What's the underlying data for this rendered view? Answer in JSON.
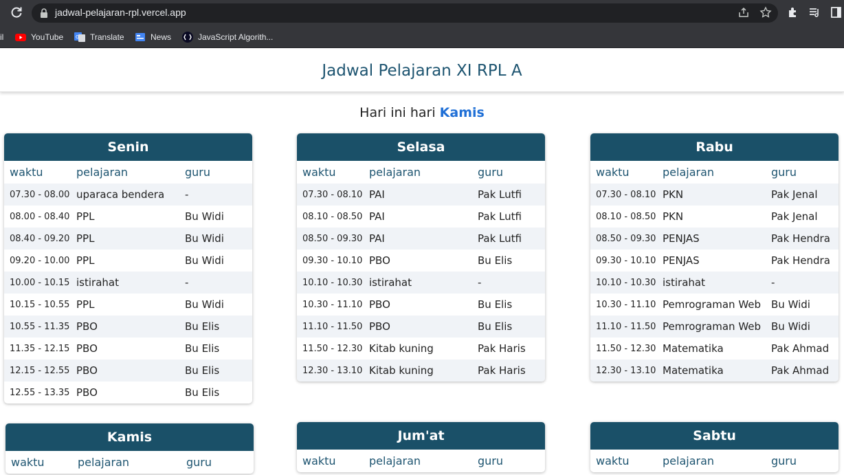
{
  "browser": {
    "url": "jadwal-pelajaran-rpl.vercel.app",
    "bookmarks": [
      {
        "label": "il",
        "icon": "bookmark-icon"
      },
      {
        "label": "YouTube",
        "icon": "youtube-icon",
        "color": "#ff0000"
      },
      {
        "label": "Translate",
        "icon": "translate-icon",
        "color": "#4285f4"
      },
      {
        "label": "News",
        "icon": "news-icon",
        "color": "#4285f4"
      },
      {
        "label": "JavaScript Algorith...",
        "icon": "freecodecamp-icon"
      }
    ]
  },
  "page": {
    "title": "Jadwal Pelajaran XI RPL A",
    "today_prefix": "Hari ini hari ",
    "today_day": "Kamis"
  },
  "colors": {
    "header": "#1a5068",
    "accent": "#1f6fd6",
    "title": "#1d5470"
  },
  "columns": {
    "time": "waktu",
    "subject": "pelajaran",
    "teacher": "guru"
  },
  "days": [
    {
      "name": "Senin",
      "rows": [
        [
          "07.30 - 08.00",
          "uparaca bendera",
          "-"
        ],
        [
          "08.00 - 08.40",
          "PPL",
          "Bu Widi"
        ],
        [
          "08.40 - 09.20",
          "PPL",
          "Bu Widi"
        ],
        [
          "09.20 - 10.00",
          "PPL",
          "Bu Widi"
        ],
        [
          "10.00 - 10.15",
          "istirahat",
          "-"
        ],
        [
          "10.15 - 10.55",
          "PPL",
          "Bu Widi"
        ],
        [
          "10.55 - 11.35",
          "PBO",
          "Bu Elis"
        ],
        [
          "11.35 - 12.15",
          "PBO",
          "Bu Elis"
        ],
        [
          "12.15 - 12.55",
          "PBO",
          "Bu Elis"
        ],
        [
          "12.55 - 13.35",
          "PBO",
          "Bu Elis"
        ]
      ]
    },
    {
      "name": "Selasa",
      "rows": [
        [
          "07.30 - 08.10",
          "PAI",
          "Pak Lutfi"
        ],
        [
          "08.10 - 08.50",
          "PAI",
          "Pak Lutfi"
        ],
        [
          "08.50 - 09.30",
          "PAI",
          "Pak Lutfi"
        ],
        [
          "09.30 - 10.10",
          "PBO",
          "Bu Elis"
        ],
        [
          "10.10 - 10.30",
          "istirahat",
          "-"
        ],
        [
          "10.30 - 11.10",
          "PBO",
          "Bu Elis"
        ],
        [
          "11.10 - 11.50",
          "PBO",
          "Bu Elis"
        ],
        [
          "11.50 - 12.30",
          "Kitab kuning",
          "Pak Haris"
        ],
        [
          "12.30 - 13.10",
          "Kitab kuning",
          "Pak Haris"
        ]
      ]
    },
    {
      "name": "Rabu",
      "rows": [
        [
          "07.30 - 08.10",
          "PKN",
          "Pak Jenal"
        ],
        [
          "08.10 - 08.50",
          "PKN",
          "Pak Jenal"
        ],
        [
          "08.50 - 09.30",
          "PENJAS",
          "Pak Hendra"
        ],
        [
          "09.30 - 10.10",
          "PENJAS",
          "Pak Hendra"
        ],
        [
          "10.10 - 10.30",
          "istirahat",
          "-"
        ],
        [
          "10.30 - 11.10",
          "Pemrograman Web",
          "Bu Widi"
        ],
        [
          "11.10 - 11.50",
          "Pemrograman Web",
          "Bu Widi"
        ],
        [
          "11.50 - 12.30",
          "Matematika",
          "Pak Ahmad"
        ],
        [
          "12.30 - 13.10",
          "Matematika",
          "Pak Ahmad"
        ]
      ]
    },
    {
      "name": "Kamis",
      "rows": []
    },
    {
      "name": "Jum'at",
      "rows": []
    },
    {
      "name": "Sabtu",
      "rows": []
    }
  ]
}
